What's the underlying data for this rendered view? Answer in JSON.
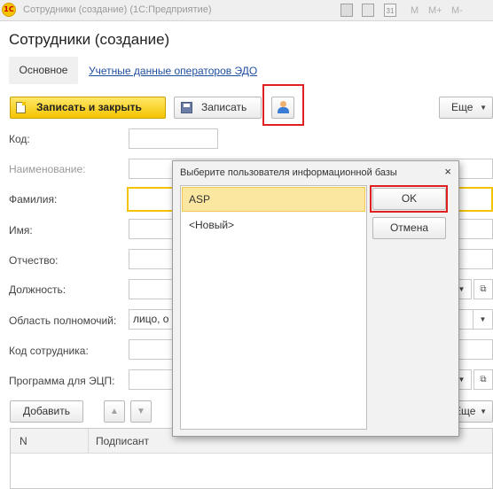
{
  "window": {
    "app_logo": "1С",
    "title": "Сотрудники (создание)  (1С:Предприятие)",
    "toolbar_icons": [
      "save-icon",
      "print-icon",
      "calendar-icon"
    ],
    "calendar_label": "31",
    "memory_buttons": [
      "M",
      "M+",
      "M-"
    ]
  },
  "form": {
    "title": "Сотрудники (создание)",
    "tabs": [
      {
        "label": "Основное",
        "active": true
      },
      {
        "label": "Учетные данные операторов ЭДО",
        "active": false
      }
    ],
    "toolbar": {
      "save_close_label": "Записать и закрыть",
      "save_label": "Записать",
      "more_label": "Еще"
    },
    "fields": {
      "code": {
        "label": "Код:",
        "value": ""
      },
      "name": {
        "label": "Наименование:",
        "value": ""
      },
      "surname": {
        "label": "Фамилия:",
        "value": ""
      },
      "first_name": {
        "label": "Имя:",
        "value": ""
      },
      "patronymic": {
        "label": "Отчество:",
        "value": ""
      },
      "position": {
        "label": "Должность:",
        "value": ""
      },
      "authority": {
        "label": "Область полномочий:",
        "value": "лицо, о"
      },
      "employee_code": {
        "label": "Код сотрудника:",
        "value": ""
      },
      "signature_program": {
        "label": "Программа для ЭЦП:",
        "value": ""
      }
    },
    "table": {
      "add_label": "Добавить",
      "up_icon": "▲",
      "down_icon": "▼",
      "more_label": "Еще",
      "columns": [
        "N",
        "Подписант"
      ],
      "rows": []
    }
  },
  "dialog": {
    "title": "Выберите пользователя информационной базы",
    "close_symbol": "×",
    "items": [
      {
        "label": "ASP",
        "selected": true
      },
      {
        "label": "<Новый>",
        "selected": false
      }
    ],
    "ok_label": "OK",
    "cancel_label": "Отмена"
  },
  "colors": {
    "accent_yellow": "#f5c400",
    "highlight_red": "#e02020",
    "link_blue": "#1f4fa0",
    "selection": "#fbe7a0"
  }
}
